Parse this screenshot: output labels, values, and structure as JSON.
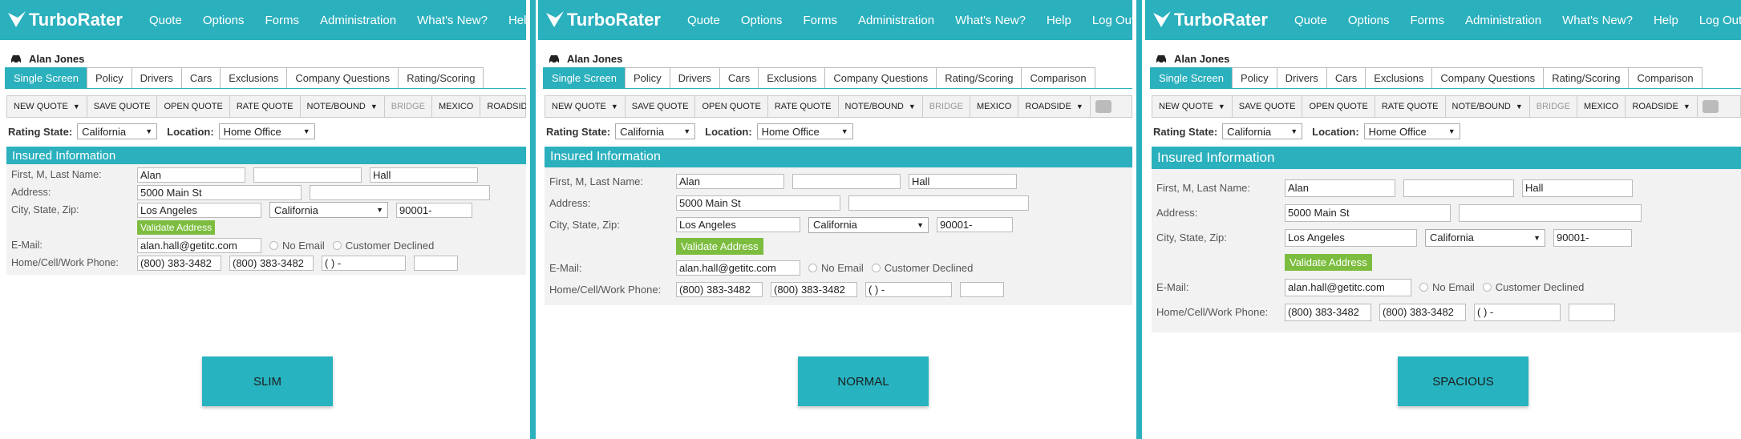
{
  "brand": {
    "name": "TurboRater",
    "color": "#2bb0bd",
    "validate_color": "#7cbd3f"
  },
  "nav": [
    "Quote",
    "Options",
    "Forms",
    "Administration",
    "What's New?",
    "Help",
    "Log Out"
  ],
  "customer": {
    "name": "Alan Jones",
    "icon": "car-icon"
  },
  "tabs": [
    "Single Screen",
    "Policy",
    "Drivers",
    "Cars",
    "Exclusions",
    "Company Questions",
    "Rating/Scoring",
    "Comparison"
  ],
  "toolbar": [
    {
      "label": "NEW QUOTE",
      "dropdown": true,
      "disabled": false
    },
    {
      "label": "SAVE QUOTE",
      "dropdown": false,
      "disabled": false
    },
    {
      "label": "OPEN QUOTE",
      "dropdown": false,
      "disabled": false
    },
    {
      "label": "RATE QUOTE",
      "dropdown": false,
      "disabled": false
    },
    {
      "label": "NOTE/BOUND",
      "dropdown": true,
      "disabled": false
    },
    {
      "label": "BRIDGE",
      "dropdown": false,
      "disabled": true
    },
    {
      "label": "MEXICO",
      "dropdown": false,
      "disabled": false
    },
    {
      "label": "ROADSIDE",
      "dropdown": true,
      "disabled": false
    }
  ],
  "filters": {
    "rating_state_label": "Rating State:",
    "rating_state_value": "California",
    "location_label": "Location:",
    "location_value": "Home Office"
  },
  "section_title": "Insured Information",
  "form": {
    "name_label": "First, M, Last Name:",
    "first": "Alan",
    "middle": "",
    "last": "Hall",
    "address_label": "Address:",
    "address1": "5000 Main St",
    "address2": "",
    "csz_label": "City, State, Zip:",
    "city": "Los Angeles",
    "state": "California",
    "zip": "90001-",
    "validate_label": "Validate Address",
    "email_label": "E-Mail:",
    "email": "alan.hall@getitc.com",
    "no_email": "No Email",
    "customer_declined": "Customer Declined",
    "phone_label": "Home/Cell/Work Phone:",
    "home_phone": "(800) 383-3482",
    "cell_phone": "(800) 383-3482",
    "work_phone": "(  )   -",
    "ext": ""
  },
  "variants": [
    {
      "label": "SLIM"
    },
    {
      "label": "NORMAL"
    },
    {
      "label": "SPACIOUS"
    }
  ]
}
